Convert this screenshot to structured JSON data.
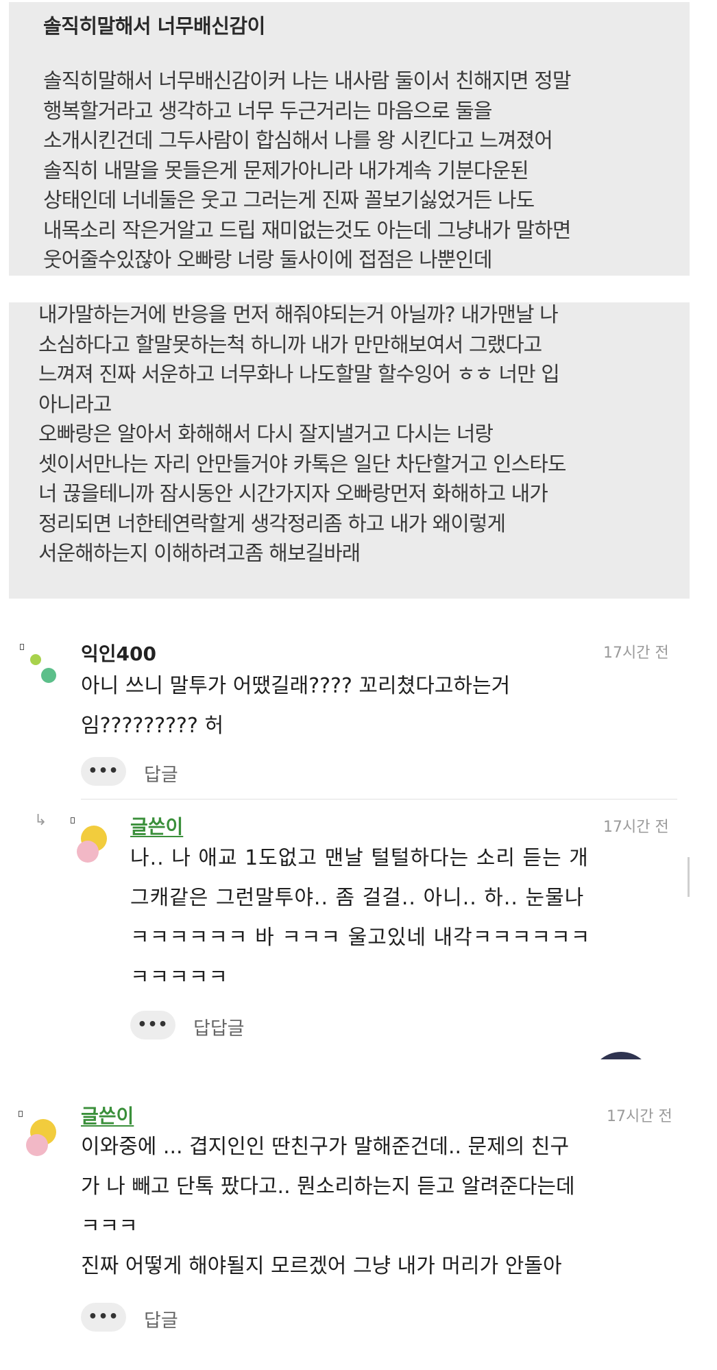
{
  "post": {
    "card1": {
      "title": "솔직히말해서 너무배신감이",
      "body": "솔직히말해서 너무배신감이커 나는 내사람 둘이서 친해지면 정말\n행복할거라고 생각하고 너무 두근거리는 마음으로 둘을\n소개시킨건데 그두사람이 합심해서 나를 왕  시킨다고 느껴졌어\n솔직히 내말을 못들은게 문제가아니라 내가계속 기분다운된\n상태인데 너네둘은 웃고 그러는게 진짜 꼴보기싫었거든 나도\n내목소리 작은거알고 드립 재미없는것도 아는데 그냥내가 말하면\n웃어줄수있잖아 오빠랑 너랑 둘사이에 접점은 나뿐인데"
    },
    "card2": {
      "body": "내가말하는거에 반응을 먼저 해줘야되는거 아닐까? 내가맨날 나\n소심하다고 할말못하는척 하니까 내가 만만해보여서 그랬다고\n느껴져 진짜 서운하고 너무화나 나도할말 할수잉어 ㅎㅎ 너만 입\n아니라고\n오빠랑은 알아서 화해해서 다시 잘지낼거고 다시는 너랑\n셋이서만나는 자리 안만들거야 카톡은 일단 차단할거고 인스타도\n너 끊을테니까 잠시동안 시간가지자 오빠랑먼저 화해하고 내가\n정리되면 너한테연락할게 생각정리좀 하고 내가 왜이렇게\n서운해하는지 이해하려고좀 해보길바래"
    }
  },
  "comments": [
    {
      "author": "익인400",
      "time": "17시간 전",
      "text": "아니 쓰니 말투가 어땠길래???? 꼬리쳤다고하는거\n임????????? 허",
      "more_label": "•••",
      "reply_label": "답글",
      "avatar_colors": [
        "#a8d24c",
        "#5cbf8a"
      ]
    },
    {
      "author": "글쓴이",
      "time": "17시간 전",
      "is_op": true,
      "reply_arrow": "↳",
      "text": "나.. 나 애교 1도없고 맨날 털털하다는 소리 듣는 개\n그캐같은 그런말투야.. 좀 걸걸.. 아니.. 하.. 눈물나\nㅋㅋㅋㅋㅋㅋ 바 ㅋㅋㅋ 울고있네 내각ㅋㅋㅋㅋㅋㅋ\nㅋㅋㅋㅋㅋ",
      "more_label": "•••",
      "reply_label": "답답글",
      "avatar_colors": [
        "#f2cc3d",
        "#f2b8c6"
      ]
    },
    {
      "author": "글쓴이",
      "time": "17시간 전",
      "is_op": true,
      "text": "이와중에 ... 겹지인인 딴친구가 말해준건데.. 문제의 친구\n가 나 빼고 단톡 팠다고.. 뭔소리하는지 듣고 알려준다는데\nㅋㅋㅋ\n진짜 어떻게 해야될지 모르겠어 그냥 내가 머리가 안돌아",
      "more_label": "•••",
      "reply_label": "답글",
      "avatar_colors": [
        "#f2cc3d",
        "#f2b8c6"
      ]
    }
  ],
  "colors": {
    "card_bg": "#ebebeb",
    "op_author": "#3a8f3a",
    "time": "#9a9a9a",
    "button_bg": "#ededed"
  }
}
